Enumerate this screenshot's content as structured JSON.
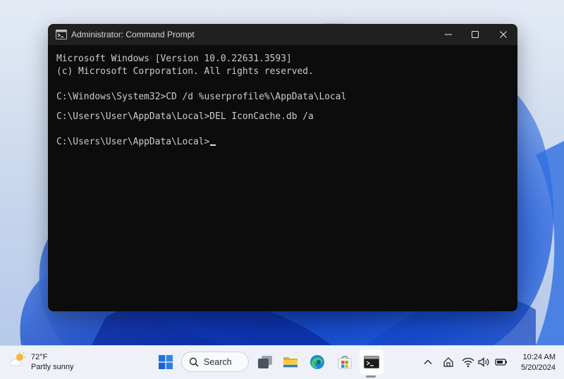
{
  "window": {
    "title": "Administrator: Command Prompt",
    "icon": "cmd-icon",
    "controls": [
      "minimize-icon",
      "maximize-icon",
      "close-icon"
    ]
  },
  "console": {
    "lines": [
      "Microsoft Windows [Version 10.0.22631.3593]",
      "(c) Microsoft Corporation. All rights reserved.",
      "C:\\Windows\\System32>CD /d %userprofile%\\AppData\\Local",
      "C:\\Users\\User\\AppData\\Local>DEL IconCache.db /a",
      "C:\\Users\\User\\AppData\\Local>"
    ]
  },
  "taskbar": {
    "weather": {
      "temp": "72°F",
      "condition": "Partly sunny",
      "icon": "partly-sunny-icon"
    },
    "search_label": "Search",
    "apps": [
      "start-icon",
      "search-icon",
      "task-view-icon",
      "file-explorer-icon",
      "edge-icon",
      "store-icon",
      "terminal-icon"
    ],
    "tray": [
      "chevron-up-icon",
      "pen-icon",
      "wifi-icon",
      "volume-icon",
      "battery-icon"
    ],
    "clock": {
      "time": "10:24 AM",
      "date": "5/20/2024"
    }
  },
  "colors": {
    "console_bg": "#0c0c0c",
    "console_text": "#cccccc",
    "titlebar_bg": "#202020",
    "taskbar_bg": "#eef2f8",
    "wallpaper_blue": "#1a4fd0"
  }
}
